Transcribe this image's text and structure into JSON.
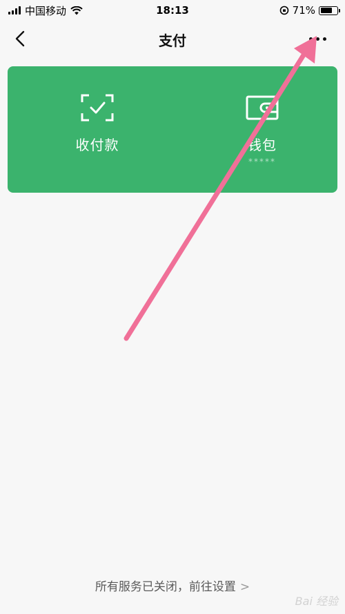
{
  "status_bar": {
    "carrier": "中国移动",
    "time": "18:13",
    "battery_percent": "71%",
    "battery_level": 0.71
  },
  "nav": {
    "title": "支付",
    "back_icon": "chevron-left-icon",
    "more_icon": "more-dots-icon"
  },
  "card": {
    "background": "#3bb36d",
    "items": [
      {
        "label": "收付款",
        "icon": "scan-check-icon"
      },
      {
        "label": "钱包",
        "icon": "wallet-icon",
        "sub": "*****"
      }
    ]
  },
  "footer": {
    "link_text": "所有服务已关闭，前往设置",
    "chevron": ">"
  },
  "watermark": "Bai 经验",
  "annotation": {
    "color": "#f07098"
  }
}
